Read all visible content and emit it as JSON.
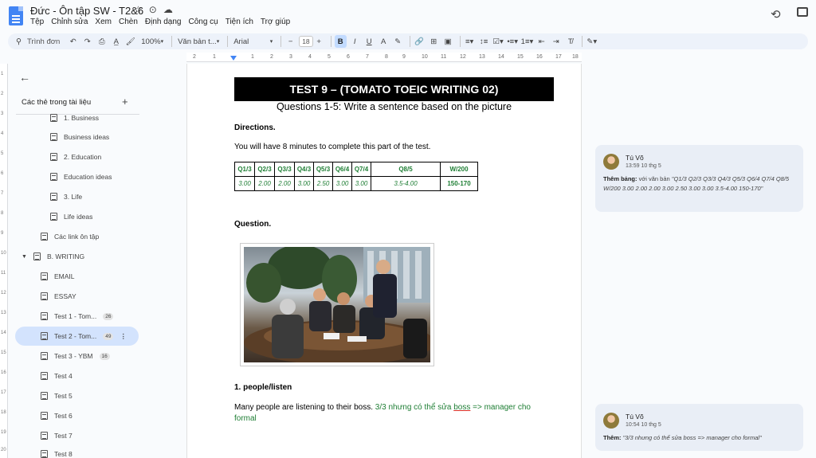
{
  "doc": {
    "title": "Đức - Ôn tập SW - T2&6",
    "menus": [
      "Tệp",
      "Chỉnh sửa",
      "Xem",
      "Chèn",
      "Định dạng",
      "Công cụ",
      "Tiện ích",
      "Trợ giúp"
    ]
  },
  "toolbar": {
    "search_placeholder": "Trình đơn",
    "zoom": "100%",
    "style": "Văn bản t...",
    "font": "Arial",
    "font_size": "18",
    "bold": "B",
    "italic": "I",
    "underline": "U",
    "text_color": "A"
  },
  "ruler": [
    "2",
    "1",
    "1",
    "2",
    "3",
    "4",
    "5",
    "6",
    "7",
    "8",
    "9",
    "10",
    "11",
    "12",
    "13",
    "14",
    "15",
    "16",
    "17",
    "18"
  ],
  "vruler": [
    "1",
    "2",
    "3",
    "4",
    "5",
    "6",
    "7",
    "8",
    "9",
    "10",
    "11",
    "12",
    "13",
    "14",
    "15",
    "16",
    "17",
    "18",
    "19",
    "20"
  ],
  "outline": {
    "heading": "Các thẻ trong tài liệu",
    "items": [
      {
        "label": "1. Business",
        "badge": ""
      },
      {
        "label": "Business ideas",
        "badge": ""
      },
      {
        "label": "2. Education",
        "badge": ""
      },
      {
        "label": "Education ideas",
        "badge": ""
      },
      {
        "label": "3. Life",
        "badge": ""
      },
      {
        "label": "Life ideas",
        "badge": ""
      },
      {
        "label": "Các link ôn tập",
        "badge": ""
      },
      {
        "label": "B. WRITING",
        "badge": ""
      },
      {
        "label": "EMAIL",
        "badge": ""
      },
      {
        "label": "ESSAY",
        "badge": ""
      },
      {
        "label": "Test 1 - Tom...",
        "badge": "26"
      },
      {
        "label": "Test 2 - Tom...",
        "badge": "49"
      },
      {
        "label": "Test 3 - YBM",
        "badge": "16"
      },
      {
        "label": "Test 4",
        "badge": ""
      },
      {
        "label": "Test 5",
        "badge": ""
      },
      {
        "label": "Test 6",
        "badge": ""
      },
      {
        "label": "Test 7",
        "badge": ""
      },
      {
        "label": "Test 8",
        "badge": ""
      }
    ]
  },
  "page": {
    "heading": "TEST 9 – (TOMATO TOEIC WRITING 02)",
    "subheading": "Questions 1-5: Write a sentence based on the picture",
    "directions_label": "Directions.",
    "directions_text": "You will have 8 minutes to complete this part of the test.",
    "score_headers": [
      "Q1/3",
      "Q2/3",
      "Q3/3",
      "Q4/3",
      "Q5/3",
      "Q6/4",
      "Q7/4",
      "Q8/5",
      "W/200"
    ],
    "score_values": [
      "3.00",
      "2.00",
      "2.00",
      "3.00",
      "2.50",
      "3.00",
      "3.00",
      "3.5-4.00",
      "150-170"
    ],
    "question_label": "Question.",
    "q1_label": "1.  people/listen",
    "q1_answer": " Many people are listening to their boss.",
    "q1_fb_a": " 3/3 nhưng có thể sửa ",
    "q1_fb_boss": "boss",
    "q1_fb_b": " => manager cho formal"
  },
  "comments": [
    {
      "author": "Tú Võ",
      "time": "13:59 10 thg 5",
      "label": "Thêm bảng:",
      "text": " với văn bản ",
      "quote": "\"Q1/3 Q2/3 Q3/3 Q4/3 Q5/3 Q6/4 Q7/4 Q8/5 W/200 3.00 2.00 2.00 3.00 2.50 3.00 3.00 3.5-4.00 150-170\""
    },
    {
      "author": "Tú Võ",
      "time": "10:54 10 thg 5",
      "label": "Thêm:",
      "text": " ",
      "quote": "\"3/3 nhưng có thể sửa boss => manager cho formal\""
    }
  ],
  "colors": {
    "accent": "#1a73e8",
    "feedback_green": "#1e7e34",
    "comment_bg": "#e9eef6",
    "active_tab": "#d3e3fd"
  }
}
